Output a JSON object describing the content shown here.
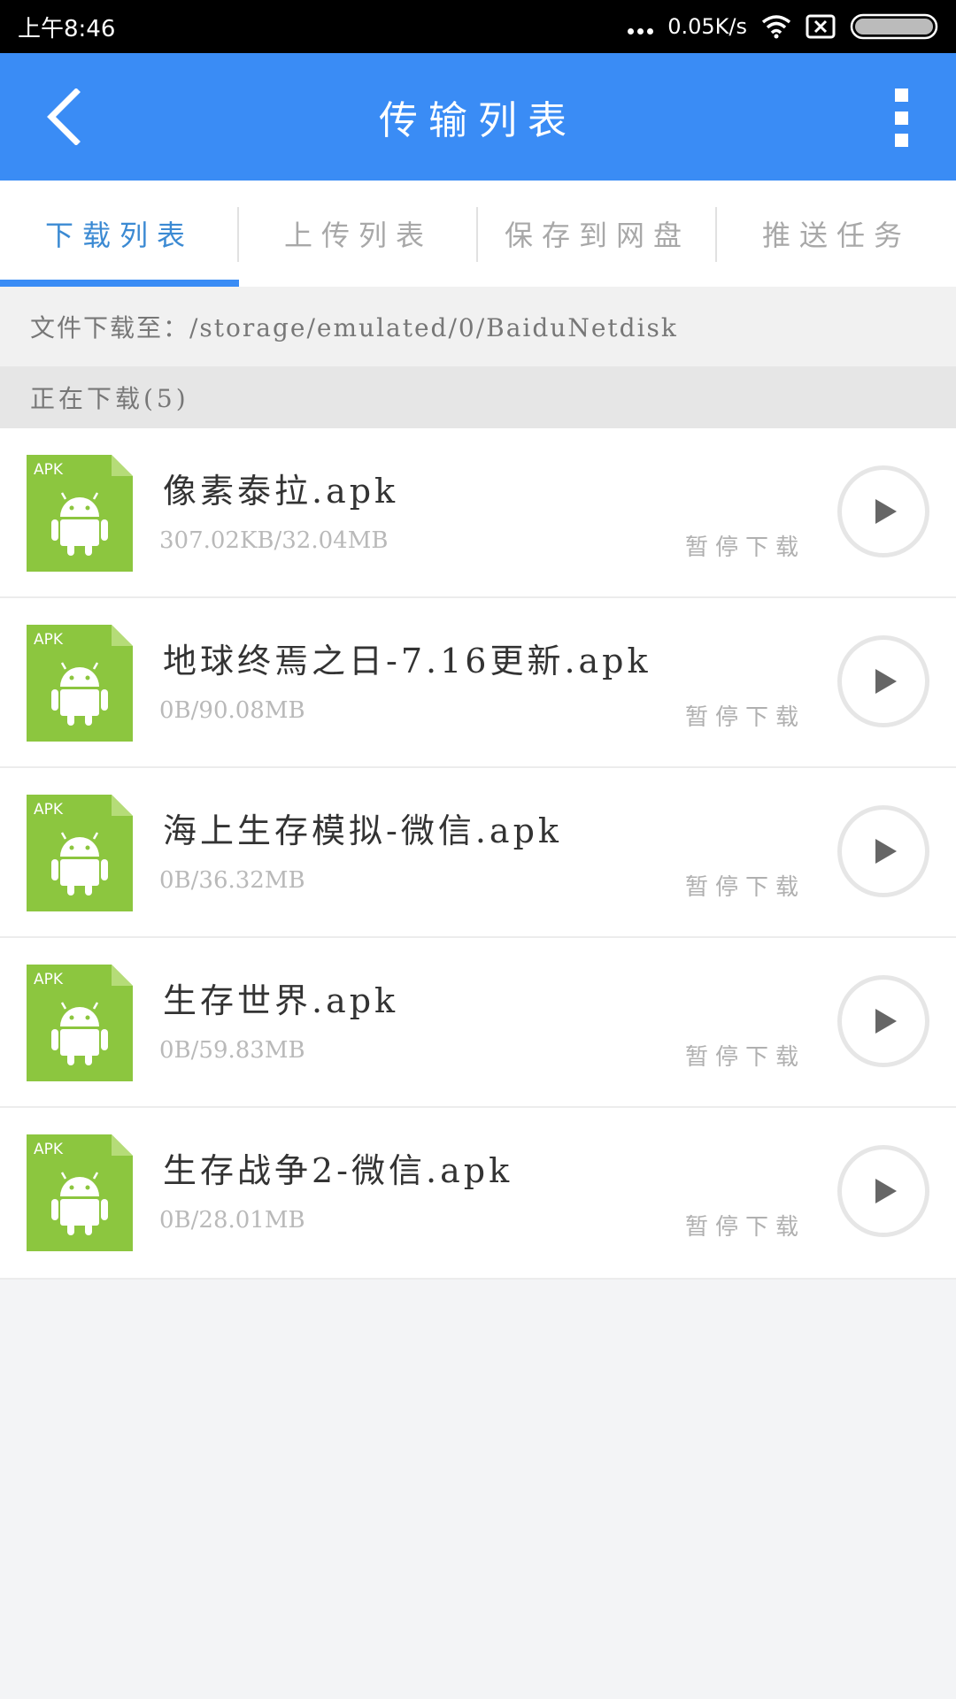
{
  "status_bar": {
    "time": "上午8:46",
    "speed": "0.05K/s",
    "icons": [
      "dots-icon",
      "wifi-icon",
      "close-box-icon",
      "battery-icon"
    ]
  },
  "app_bar": {
    "title": "传输列表",
    "back_icon": "chevron-left-icon",
    "more_icon": "more-vertical-icon"
  },
  "tabs": [
    {
      "label": "下载列表",
      "active": true
    },
    {
      "label": "上传列表",
      "active": false
    },
    {
      "label": "保存到网盘",
      "active": false
    },
    {
      "label": "推送任务",
      "active": false
    }
  ],
  "path_text": "文件下载至：/storage/emulated/0/BaiduNetdisk",
  "section_header": "正在下载(5)",
  "downloads": [
    {
      "name": "像素泰拉.apk",
      "size": "307.02KB/32.04MB",
      "status": "暂停下载",
      "icon_label": "APK"
    },
    {
      "name": "地球终焉之日-7.16更新.apk",
      "size": "0B/90.08MB",
      "status": "暂停下载",
      "icon_label": "APK"
    },
    {
      "name": "海上生存模拟-微信.apk",
      "size": "0B/36.32MB",
      "status": "暂停下载",
      "icon_label": "APK"
    },
    {
      "name": "生存世界.apk",
      "size": "0B/59.83MB",
      "status": "暂停下载",
      "icon_label": "APK"
    },
    {
      "name": "生存战争2-微信.apk",
      "size": "0B/28.01MB",
      "status": "暂停下载",
      "icon_label": "APK"
    }
  ],
  "colors": {
    "app_bar": "#3a8cf5",
    "tab_active": "#3b8ad3",
    "apk_green": "#8cc63f"
  }
}
